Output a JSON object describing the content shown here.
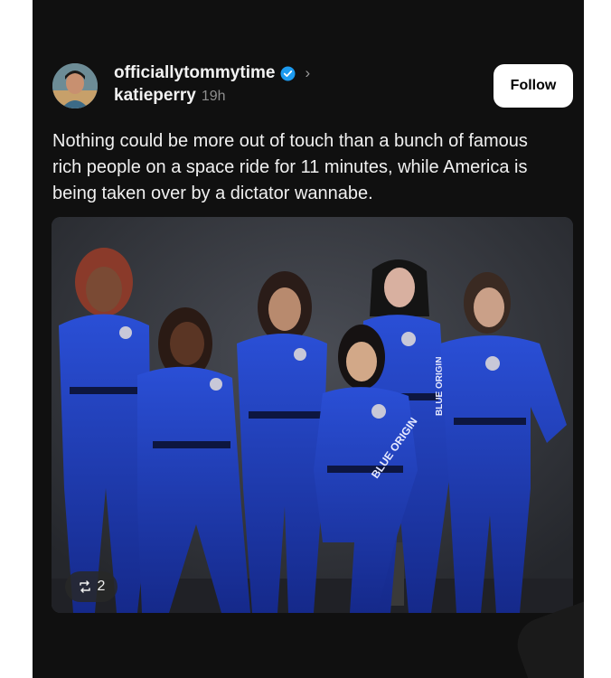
{
  "post": {
    "username": "officiallytommytime",
    "reposted_by": "katieperry",
    "time": "19h",
    "follow_label": "Follow",
    "text": "Nothing could be more out of touch  than a bunch of famous rich people on a space ride for 11 minutes, while America is being taken over by a dictator wannabe.",
    "repost_count": "2"
  },
  "icons": {
    "verified": "verified-badge-icon",
    "chevron": "chevron-right-icon",
    "repost": "repost-icon"
  },
  "colors": {
    "background": "#101010",
    "text": "#f0f0f0",
    "verified": "#1d9bf0",
    "suit_blue": "#1f3fc0"
  },
  "photo": {
    "suit_text": "BLUE ORIGIN"
  }
}
